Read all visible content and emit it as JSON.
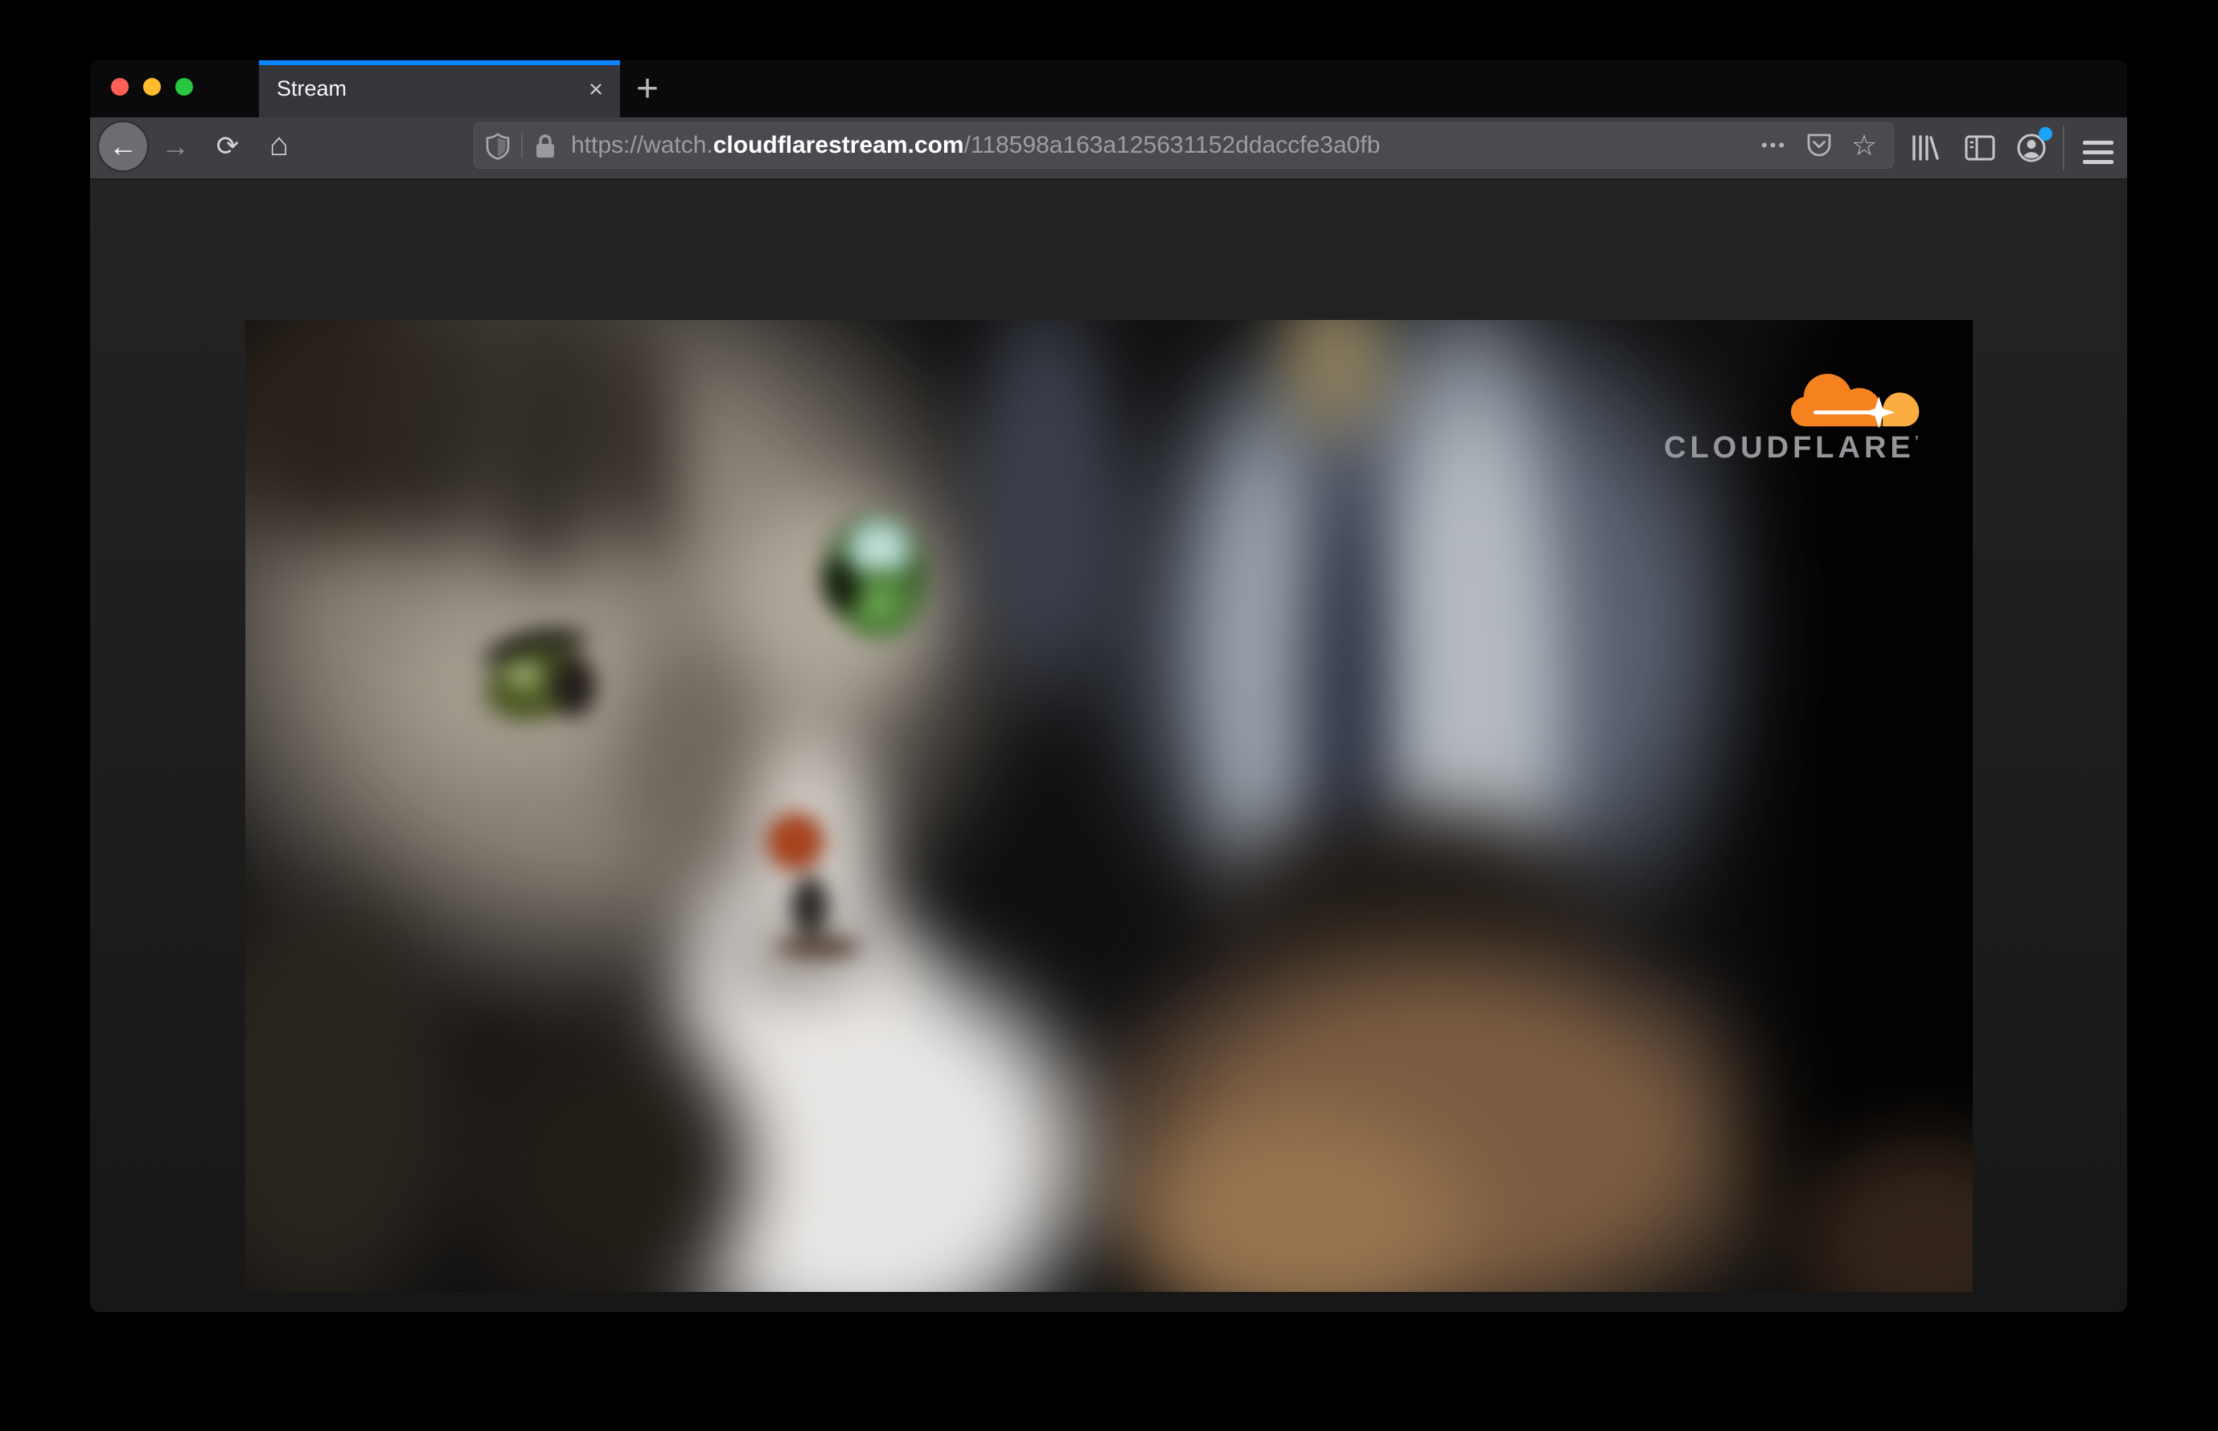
{
  "browser": {
    "window_controls": {
      "close_color": "#ff5f57",
      "minimize_color": "#febc2e",
      "zoom_color": "#28c840"
    },
    "tab": {
      "title": "Stream"
    },
    "glyphs": {
      "close_tab": "×",
      "new_tab": "+",
      "back": "←",
      "forward": "→",
      "reload": "⟳",
      "home": "⌂",
      "page_actions": "•••",
      "bookmark_star": "☆"
    },
    "url": {
      "prefix": "https://watch.",
      "domain": "cloudflarestream.com",
      "path": "/118598a163a125631152ddaccfe3a0fb"
    },
    "accent_color": "#0a84ff",
    "notification_dot_color": "#1ba1f8"
  },
  "page": {
    "brand": {
      "wordmark": "CLOUDFLARE",
      "tm": "’",
      "cloud_orange": "#f6821f",
      "cloud_light_orange": "#fbad41",
      "wordmark_color": "#95959a"
    },
    "video": {
      "description": "Blurred close-up video frame of a grey tabby cat with green eyes"
    }
  }
}
